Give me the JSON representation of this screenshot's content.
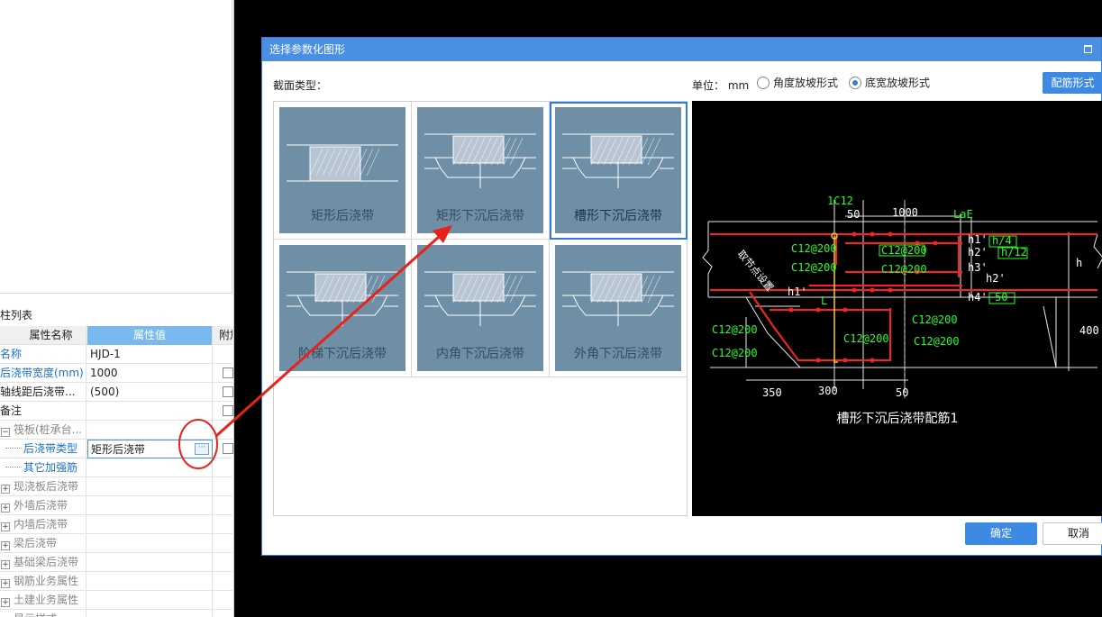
{
  "prop_panel": {
    "section_title": "柱列表",
    "col_name_header": "属性名称",
    "col_value_header": "属性值",
    "col_extra_header": "附加",
    "rows": [
      {
        "name": "名称",
        "value": "HJD-1",
        "checkbox": false
      },
      {
        "name": "后浇带宽度(mm)",
        "value": "1000",
        "checkbox": true
      },
      {
        "name": "轴线距后浇带...",
        "value": "(500)",
        "checkbox": true
      },
      {
        "name": "备注",
        "value": "",
        "checkbox": true
      }
    ],
    "group_raft": "筏板(桩承台...",
    "sub_type_name": "后浇带类型",
    "sub_type_value": "矩形后浇带",
    "more_button": "···",
    "sub_other": "其它加强筋",
    "groups": [
      "现浇板后浇带",
      "外墙后浇带",
      "内墙后浇带",
      "梁后浇带",
      "基础梁后浇带",
      "钢筋业务属性",
      "土建业务属性",
      "显示样式"
    ]
  },
  "dialog": {
    "title": "选择参数化图形",
    "section_label": "截面类型：",
    "unit_label": "单位： mm",
    "radio_angle": "角度放坡形式",
    "radio_width": "底宽放坡形式",
    "rebar_button": "配筋形式",
    "ok": "确定",
    "cancel": "取消",
    "shapes": [
      {
        "label": "矩形后浇带",
        "selected": false,
        "variant": "rect"
      },
      {
        "label": "矩形下沉后浇带",
        "selected": false,
        "variant": "sunk"
      },
      {
        "label": "槽形下沉后浇带",
        "selected": true,
        "variant": "trough"
      },
      {
        "label": "阶梯下沉后浇带",
        "selected": false,
        "variant": "step"
      },
      {
        "label": "内角下沉后浇带",
        "selected": false,
        "variant": "inner"
      },
      {
        "label": "外角下沉后浇带",
        "selected": false,
        "variant": "outer"
      }
    ]
  },
  "preview": {
    "caption": "槽形下沉后浇带配筋1",
    "labels": {
      "c12_top": "1C12",
      "dim_50": "50",
      "dim_1000": "1000",
      "lae": "LaE",
      "h1_top": "h1'",
      "h_4": "h/4",
      "h2_top": "h2'",
      "h_12": "h/12",
      "h3": "h3'",
      "h2_mid": "h2'",
      "h4": "h4'",
      "dim_50b": "50",
      "h": "h",
      "h1_left": "h1'",
      "L": "L",
      "c12_1": "C12@200",
      "c12_2": "C12@200",
      "c12_3": "C12@200",
      "c12_4": "C12@200",
      "c12_5": "C12@200",
      "c12_6": "C12@200",
      "c12_7": "C12@200",
      "c12_8": "C12@200",
      "c12_9": "C12@200",
      "dim_400": "400",
      "dim_350": "350",
      "dim_300": "300",
      "dim_50c": "50",
      "slope": "取节点设置"
    }
  },
  "colors": {
    "titlebar": "#4a90e2",
    "thumb": "#6f8fa6",
    "selected_border": "#2f7ce0",
    "rebar": "#ff2020",
    "dim_text": "#22ff22",
    "annotation": "#e8221b"
  }
}
